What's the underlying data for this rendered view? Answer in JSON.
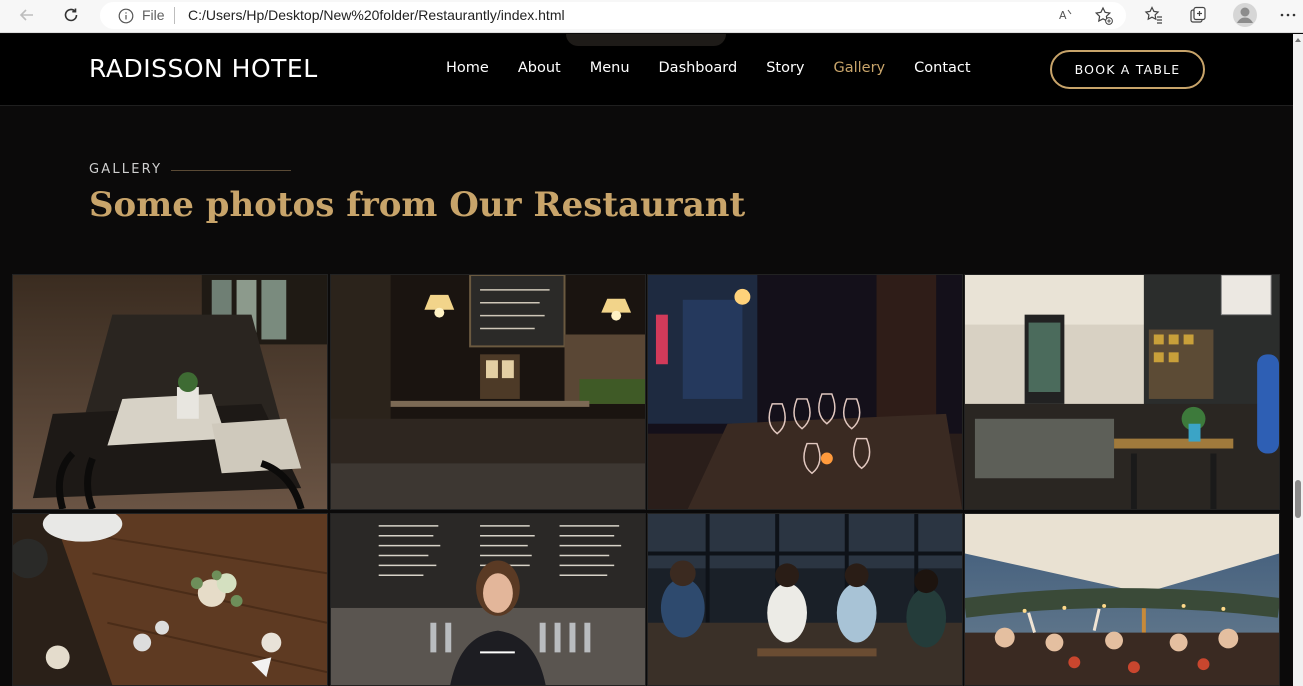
{
  "browser": {
    "file_label": "File",
    "url": "C:/Users/Hp/Desktop/New%20folder/Restaurantly/index.html",
    "reader_icon_text": "À"
  },
  "site": {
    "logo": "RADISSON HOTEL",
    "nav": [
      {
        "label": "Home",
        "active": false
      },
      {
        "label": "About",
        "active": false
      },
      {
        "label": "Menu",
        "active": false
      },
      {
        "label": "Dashboard",
        "active": false
      },
      {
        "label": "Story",
        "active": false
      },
      {
        "label": "Gallery",
        "active": true
      },
      {
        "label": "Contact",
        "active": false
      }
    ],
    "book_button": "BOOK A TABLE"
  },
  "gallery_section": {
    "eyebrow": "GALLERY",
    "title": "Some photos from Our Restaurant",
    "photos": [
      {
        "subject": "restaurant dining tables with chairs"
      },
      {
        "subject": "dim bar interior with hanging lamps and chalkboard"
      },
      {
        "subject": "wine glasses on table at night"
      },
      {
        "subject": "cafe counter with shelves"
      },
      {
        "subject": "wooden table with plates and flowers from above"
      },
      {
        "subject": "woman in front of beer tap menu board"
      },
      {
        "subject": "friends sitting at restaurant window"
      },
      {
        "subject": "outdoor tent dinner party toasting"
      }
    ]
  },
  "colors": {
    "accent": "#c8a46a",
    "background": "#0b0a0a",
    "header": "#000000"
  }
}
